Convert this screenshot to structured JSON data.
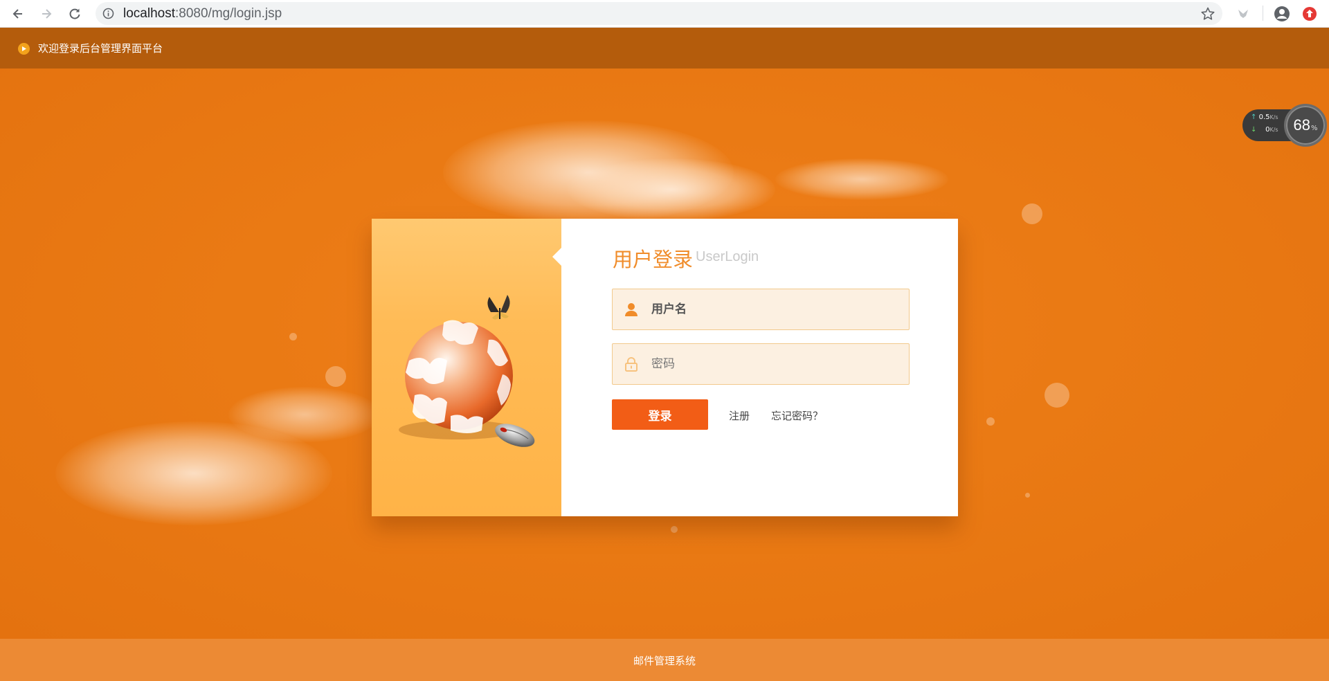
{
  "browser": {
    "url_host": "localhost",
    "url_path": ":8080/mg/login.jsp",
    "icons": [
      "back-arrow-icon",
      "forward-arrow-icon",
      "reload-icon",
      "info-icon",
      "star-icon",
      "extension-bird-icon",
      "account-icon",
      "update-icon"
    ]
  },
  "header": {
    "title": "欢迎登录后台管理界面平台"
  },
  "speed_widget": {
    "upload": "0.5",
    "download": "0",
    "unit": "K/s",
    "percent": "68",
    "percent_unit": "%"
  },
  "login": {
    "title": "用户登录",
    "title_en": "UserLogin",
    "username_placeholder": "用户名",
    "password_placeholder": "密码",
    "submit_label": "登录",
    "register_label": "注册",
    "forgot_label": "忘记密码？"
  },
  "footer": {
    "text": "邮件管理系统"
  },
  "colors": {
    "header_bg": "#b45c0c",
    "stage_bg": "#ea7a14",
    "footer_bg": "#ec8a34",
    "accent": "#f25d16",
    "title_orange": "#f08c2a",
    "field_bg": "#fcf0e1"
  }
}
